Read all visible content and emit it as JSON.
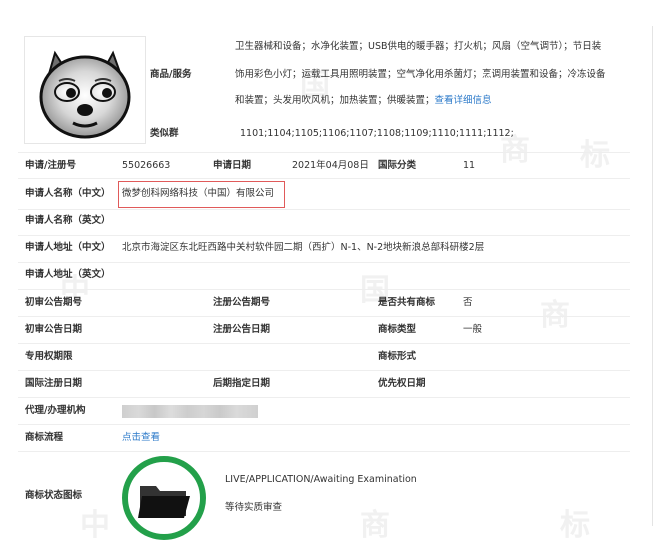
{
  "goods": {
    "label": "商品/服务",
    "lines": [
      "卫生器械和设备；水净化装置；USB供电的暖手器；打火机；风扇（空气调节）；节日装",
      "饰用彩色小灯；运载工具用照明装置；空气净化用杀菌灯；烹调用装置和设备；冷冻设备",
      "和装置；头发用吹风机；加热装置；供暖装置；"
    ],
    "more_link": "查看详细信息"
  },
  "class_group": {
    "label": "类似群",
    "value": "1101;1104;1105;1106;1107;1108;1109;1110;1111;1112;"
  },
  "fields": {
    "reg_no_label": "申请/注册号",
    "reg_no_value": "55026663",
    "app_date_label": "申请日期",
    "app_date_value": "2021年04月08日",
    "intl_class_label": "国际分类",
    "intl_class_value": "11",
    "applicant_cn_label": "申请人名称（中文）",
    "applicant_cn_value": "微梦创科网络科技（中国）有限公司",
    "applicant_en_label": "申请人名称（英文）",
    "address_cn_label": "申请人地址（中文）",
    "address_cn_value": "北京市海淀区东北旺西路中关村软件园二期（西扩）N-1、N-2地块新浪总部科研楼2层",
    "address_en_label": "申请人地址（英文）",
    "prelim_no_label": "初审公告期号",
    "reg_pub_no_label": "注册公告期号",
    "shared_label": "是否共有商标",
    "shared_value": "否",
    "prelim_date_label": "初审公告日期",
    "reg_pub_date_label": "注册公告日期",
    "type_label": "商标类型",
    "type_value": "一般",
    "exclusive_label": "专用权期限",
    "form_label": "商标形式",
    "intl_reg_date_label": "国际注册日期",
    "later_date_label": "后期指定日期",
    "priority_date_label": "优先权日期",
    "agent_label": "代理/办理机构",
    "flow_label": "商标流程",
    "flow_link": "点击查看",
    "status_label": "商标状态图标"
  },
  "status": {
    "en": "LIVE/APPLICATION/Awaiting Examination",
    "cn": "等待实质审查",
    "color": "#23a04a"
  },
  "watermark": {
    "chars": [
      "中",
      "国",
      "商",
      "标"
    ]
  },
  "colors": {
    "link": "#2b79c9",
    "highlight_border": "#e05a5a"
  },
  "icons": {
    "logo": "doge-dog-logo-image",
    "status": "folder-icon"
  }
}
